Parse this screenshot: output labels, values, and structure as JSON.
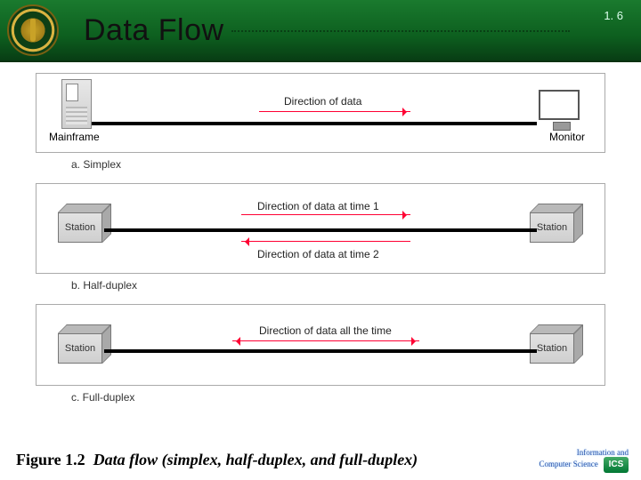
{
  "header": {
    "title": "Data Flow",
    "page_number": "1. 6"
  },
  "panels": {
    "a": {
      "caption": "a. Simplex",
      "left_device": "Mainframe",
      "right_device": "Monitor",
      "arrow1_label": "Direction of data"
    },
    "b": {
      "caption": "b. Half-duplex",
      "left_device": "Station",
      "right_device": "Station",
      "arrow1_label": "Direction of data at time 1",
      "arrow2_label": "Direction of data at time 2"
    },
    "c": {
      "caption": "c. Full-duplex",
      "left_device": "Station",
      "right_device": "Station",
      "arrow1_label": "Direction of data all the time"
    }
  },
  "figure": {
    "number": "Figure 1.2",
    "caption": "Data flow (simplex, half-duplex, and full-duplex)"
  },
  "footer": {
    "dept_line1": "Information and",
    "dept_line2": "Computer Science",
    "badge": "ICS"
  }
}
